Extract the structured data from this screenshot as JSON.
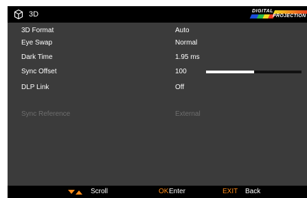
{
  "header": {
    "title": "3D",
    "icon": "3d-cube-icon",
    "logo_line1": "DIGITAL",
    "logo_line2": "PROJECTION"
  },
  "menu": {
    "items": [
      {
        "label": "3D Format",
        "value": "Auto"
      },
      {
        "label": "Eye Swap",
        "value": "Normal"
      },
      {
        "label": "Dark Time",
        "value": "1.95 ms"
      },
      {
        "label": "Sync Offset",
        "value": "100",
        "slider_fraction": 0.5
      },
      {
        "label": "DLP Link",
        "value": "Off"
      }
    ],
    "disabled_items": [
      {
        "label": "Sync Reference",
        "value": "External"
      }
    ]
  },
  "footer": {
    "scroll_icon": "up-down-arrows-icon",
    "scroll_label": "Scroll",
    "ok_key": "OK",
    "ok_label": "Enter",
    "exit_key": "EXIT",
    "exit_label": "Back"
  },
  "colors": {
    "background": "#3b3b3b",
    "bar": "#000000",
    "key_accent": "#ff8c1a",
    "disabled_text": "#6e6e6e"
  }
}
